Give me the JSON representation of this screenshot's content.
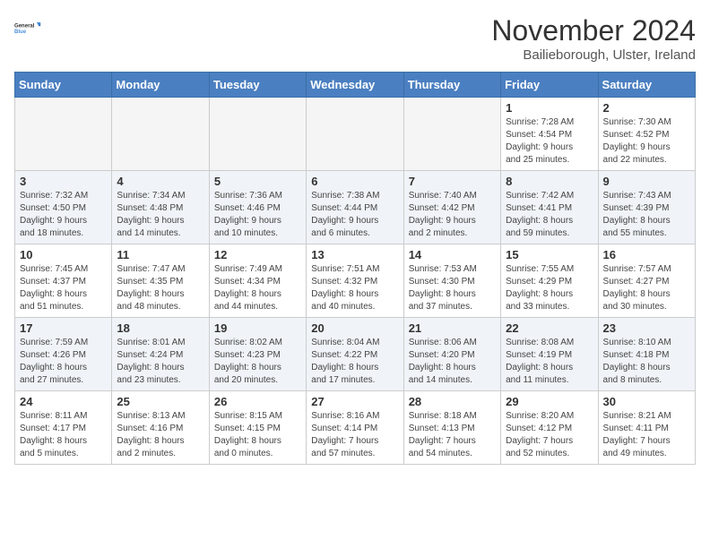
{
  "logo": {
    "line1": "General",
    "line2": "Blue"
  },
  "title": "November 2024",
  "location": "Bailieborough, Ulster, Ireland",
  "headers": [
    "Sunday",
    "Monday",
    "Tuesday",
    "Wednesday",
    "Thursday",
    "Friday",
    "Saturday"
  ],
  "weeks": [
    [
      {
        "day": "",
        "info": ""
      },
      {
        "day": "",
        "info": ""
      },
      {
        "day": "",
        "info": ""
      },
      {
        "day": "",
        "info": ""
      },
      {
        "day": "",
        "info": ""
      },
      {
        "day": "1",
        "info": "Sunrise: 7:28 AM\nSunset: 4:54 PM\nDaylight: 9 hours\nand 25 minutes."
      },
      {
        "day": "2",
        "info": "Sunrise: 7:30 AM\nSunset: 4:52 PM\nDaylight: 9 hours\nand 22 minutes."
      }
    ],
    [
      {
        "day": "3",
        "info": "Sunrise: 7:32 AM\nSunset: 4:50 PM\nDaylight: 9 hours\nand 18 minutes."
      },
      {
        "day": "4",
        "info": "Sunrise: 7:34 AM\nSunset: 4:48 PM\nDaylight: 9 hours\nand 14 minutes."
      },
      {
        "day": "5",
        "info": "Sunrise: 7:36 AM\nSunset: 4:46 PM\nDaylight: 9 hours\nand 10 minutes."
      },
      {
        "day": "6",
        "info": "Sunrise: 7:38 AM\nSunset: 4:44 PM\nDaylight: 9 hours\nand 6 minutes."
      },
      {
        "day": "7",
        "info": "Sunrise: 7:40 AM\nSunset: 4:42 PM\nDaylight: 9 hours\nand 2 minutes."
      },
      {
        "day": "8",
        "info": "Sunrise: 7:42 AM\nSunset: 4:41 PM\nDaylight: 8 hours\nand 59 minutes."
      },
      {
        "day": "9",
        "info": "Sunrise: 7:43 AM\nSunset: 4:39 PM\nDaylight: 8 hours\nand 55 minutes."
      }
    ],
    [
      {
        "day": "10",
        "info": "Sunrise: 7:45 AM\nSunset: 4:37 PM\nDaylight: 8 hours\nand 51 minutes."
      },
      {
        "day": "11",
        "info": "Sunrise: 7:47 AM\nSunset: 4:35 PM\nDaylight: 8 hours\nand 48 minutes."
      },
      {
        "day": "12",
        "info": "Sunrise: 7:49 AM\nSunset: 4:34 PM\nDaylight: 8 hours\nand 44 minutes."
      },
      {
        "day": "13",
        "info": "Sunrise: 7:51 AM\nSunset: 4:32 PM\nDaylight: 8 hours\nand 40 minutes."
      },
      {
        "day": "14",
        "info": "Sunrise: 7:53 AM\nSunset: 4:30 PM\nDaylight: 8 hours\nand 37 minutes."
      },
      {
        "day": "15",
        "info": "Sunrise: 7:55 AM\nSunset: 4:29 PM\nDaylight: 8 hours\nand 33 minutes."
      },
      {
        "day": "16",
        "info": "Sunrise: 7:57 AM\nSunset: 4:27 PM\nDaylight: 8 hours\nand 30 minutes."
      }
    ],
    [
      {
        "day": "17",
        "info": "Sunrise: 7:59 AM\nSunset: 4:26 PM\nDaylight: 8 hours\nand 27 minutes."
      },
      {
        "day": "18",
        "info": "Sunrise: 8:01 AM\nSunset: 4:24 PM\nDaylight: 8 hours\nand 23 minutes."
      },
      {
        "day": "19",
        "info": "Sunrise: 8:02 AM\nSunset: 4:23 PM\nDaylight: 8 hours\nand 20 minutes."
      },
      {
        "day": "20",
        "info": "Sunrise: 8:04 AM\nSunset: 4:22 PM\nDaylight: 8 hours\nand 17 minutes."
      },
      {
        "day": "21",
        "info": "Sunrise: 8:06 AM\nSunset: 4:20 PM\nDaylight: 8 hours\nand 14 minutes."
      },
      {
        "day": "22",
        "info": "Sunrise: 8:08 AM\nSunset: 4:19 PM\nDaylight: 8 hours\nand 11 minutes."
      },
      {
        "day": "23",
        "info": "Sunrise: 8:10 AM\nSunset: 4:18 PM\nDaylight: 8 hours\nand 8 minutes."
      }
    ],
    [
      {
        "day": "24",
        "info": "Sunrise: 8:11 AM\nSunset: 4:17 PM\nDaylight: 8 hours\nand 5 minutes."
      },
      {
        "day": "25",
        "info": "Sunrise: 8:13 AM\nSunset: 4:16 PM\nDaylight: 8 hours\nand 2 minutes."
      },
      {
        "day": "26",
        "info": "Sunrise: 8:15 AM\nSunset: 4:15 PM\nDaylight: 8 hours\nand 0 minutes."
      },
      {
        "day": "27",
        "info": "Sunrise: 8:16 AM\nSunset: 4:14 PM\nDaylight: 7 hours\nand 57 minutes."
      },
      {
        "day": "28",
        "info": "Sunrise: 8:18 AM\nSunset: 4:13 PM\nDaylight: 7 hours\nand 54 minutes."
      },
      {
        "day": "29",
        "info": "Sunrise: 8:20 AM\nSunset: 4:12 PM\nDaylight: 7 hours\nand 52 minutes."
      },
      {
        "day": "30",
        "info": "Sunrise: 8:21 AM\nSunset: 4:11 PM\nDaylight: 7 hours\nand 49 minutes."
      }
    ]
  ]
}
